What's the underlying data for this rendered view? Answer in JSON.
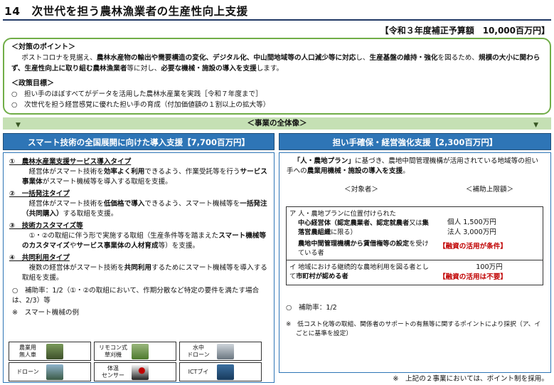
{
  "title": "14　次世代を担う農林漁業者の生産性向上支援",
  "budget": "【令和３年度補正予算額　10,000百万円】",
  "policy_points": {
    "heading": "＜対策のポイント＞",
    "p1": "ポストコロナを見据え、",
    "p2": "農林水産物の輸出や需要構造の変化、デジタル化、中山間地域等の人口減少等に対応",
    "p3": "し、",
    "p4": "生産基盤の維持・強化",
    "p5": "を図るため、",
    "p6": "規模の大小に関わらず、生産性向上に取り組む農林漁業者",
    "p7": "等に対し、",
    "p8": "必要な機械・施設の導入を支援",
    "p9": "します。"
  },
  "policy_goals": {
    "heading": "＜政策目標＞",
    "g1": "○　担い手のほぼすべてがデータを活用した農林水産業を実践［令和７年度まで］",
    "g2": "○　次世代を担う経営感覚に優れた担い手の育成（付加価値額の１割以上の拡大等）"
  },
  "overview": "＜事業の全体像＞",
  "left": {
    "header": "スマート技術の全国展開に向けた導入支援【7,700百万円】",
    "i1_title": "①　農林水産業支援サービス導入タイプ",
    "i1_a": "経営体がスマート技術を",
    "i1_b": "効率よく利用",
    "i1_c": "できるよう、作業受託等を行う",
    "i1_d": "サービス事業体",
    "i1_e": "がスマート機械等を導入する取組を支援。",
    "i2_title": "②　一括発注タイプ",
    "i2_a": "経営体がスマート技術を",
    "i2_b": "低価格で導入",
    "i2_c": "できるよう、スマート機械等を",
    "i2_d": "一括発注（共同購入）",
    "i2_e": "する取組を支援。",
    "i3_title": "③　技術カスタマイズ等",
    "i3_a": "①・②の取組に伴う形で実施する取組（生産条件等を踏まえた",
    "i3_b": "スマート機械等のカスタマイズ",
    "i3_c": "や",
    "i3_d": "サービス事業体の人材育成",
    "i3_e": "等）を支援。",
    "i4_title": "④　共同利用タイプ",
    "i4_a": "複数の経営体がスマート技術を",
    "i4_b": "共同利用",
    "i4_c": "するためにスマート機械等を導入する取組を支援。",
    "subsidy": "○　補助率：1/2（①・②の取組において、作期分散など特定の要件を満たす場合は、2/3）等",
    "equip_label": "※　スマート機械の例",
    "equip": [
      "農業用\n無人車",
      "リモコン式\n草刈機",
      "水中\nドローン",
      "ドローン",
      "体温\nセンサー",
      "ICTブイ"
    ]
  },
  "right": {
    "header": "担い手確保・経営強化支援【2,300百万円】",
    "intro_a": "「人・農地プラン」",
    "intro_b": "に基づき、農地中間管理機構が活用されている地域等の担い手への",
    "intro_c": "農業用機械・施設の導入を支援",
    "intro_d": "。",
    "col1": "＜対象者＞",
    "col2": "＜補助上限額＞",
    "r1_a": "ア 人・農地プランに位置付けられた",
    "r1_b": "中心経営体（認定農業者、認定就農者",
    "r1_c": "又は",
    "r1_d": "集落営農組織",
    "r1_e": "に限る）",
    "r1_f": "農地中間管理機構から賃借権等の設定",
    "r1_g": "を受けている者",
    "r1_lim1": "個人 1,500万円",
    "r1_lim2": "法人 3,000万円",
    "r1_note": "【融資の活用が条件】",
    "r2_a": "イ 地域における継続的な農地利用を図る者として",
    "r2_b": "市町村が認める者",
    "r2_lim": "100万円",
    "r2_note": "【融資の活用は不要】",
    "subsidy": "○　補助率：1/2",
    "note": "※　低コスト化等の取組、関係者のサポートの有無等に関するポイントにより採択（ア、イごとに基準を設定）"
  },
  "footnote": "※　上記の２事業においては、ポイント制を採用。"
}
